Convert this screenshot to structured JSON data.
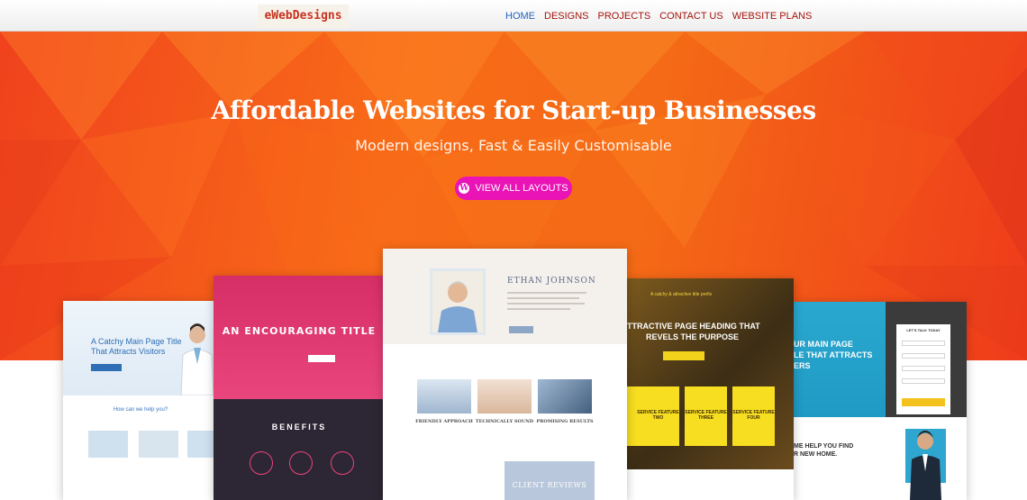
{
  "brand": {
    "logo": "eWebDesigns"
  },
  "nav": {
    "items": [
      "HOME",
      "DESIGNS",
      "PROJECTS",
      "CONTACT US",
      "WEBSITE PLANS"
    ],
    "active": "HOME"
  },
  "hero": {
    "title": "Affordable Websites for Start-up Businesses",
    "subtitle": "Modern designs, Fast & Easily Customisable",
    "cta_label": "VIEW ALL LAYOUTS"
  },
  "previews": {
    "medical": {
      "title": "A Catchy Main Page Title",
      "subtitle": "That Attracts Visitors",
      "help": "How can we help you?"
    },
    "pink": {
      "title": "AN ENCOURAGING TITLE",
      "benefits": "BENEFITS"
    },
    "profile": {
      "name": "ETHAN JOHNSON",
      "services": [
        "FRIENDLY APPROACH",
        "TECHNICALLY SOUND",
        "PROMISING RESULTS"
      ],
      "reviews": "CLIENT REVIEWS"
    },
    "construction": {
      "tagline": "A catchy & attractive title prefix",
      "heading_line1": "TTRACTIVE PAGE HEADING THAT",
      "heading_line2": "REVELS THE PURPOSE",
      "features": [
        "SERVICE FEATURE TWO",
        "SERVICE FEATURE THREE",
        "SERVICE FEATURE FOUR"
      ]
    },
    "realestate": {
      "heading_line1": "UR MAIN PAGE",
      "heading_line2": "LE THAT ATTRACTS",
      "heading_line3": "ERS",
      "form_title": "LET'S TALK TODAY",
      "help_line1": "ME HELP YOU FIND",
      "help_line2": "R NEW HOME."
    }
  },
  "colors": {
    "accent_orange": "#f86b18",
    "cta_magenta": "#e913b6",
    "nav_red": "#a4130b",
    "nav_active_blue": "#1f63c1"
  }
}
